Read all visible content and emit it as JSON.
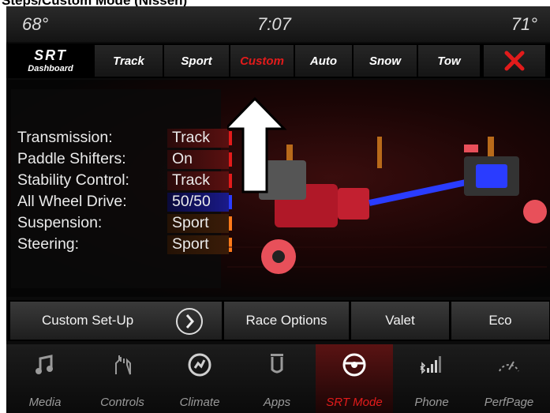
{
  "caption": "Steps/Custom Mode (Nissen)",
  "status": {
    "temp_left": "68°",
    "time": "7:07",
    "temp_right": "71°"
  },
  "tabs": {
    "logo_big": "SRT",
    "logo_small": "Dashboard",
    "items": [
      "Track",
      "Sport",
      "Custom",
      "Auto",
      "Snow",
      "Tow"
    ],
    "active": "Custom"
  },
  "settings": [
    {
      "label": "Transmission:",
      "value": "Track",
      "color": "#e21b1b"
    },
    {
      "label": "Paddle Shifters:",
      "value": "On",
      "color": "#e21b1b"
    },
    {
      "label": "Stability Control:",
      "value": "Track",
      "color": "#e21b1b"
    },
    {
      "label": "All Wheel Drive:",
      "value": "50/50",
      "color": "#2a3cff"
    },
    {
      "label": "Suspension:",
      "value": "Sport",
      "color": "#ff7a1a"
    },
    {
      "label": "Steering:",
      "value": "Sport",
      "color": "#ff7a1a"
    }
  ],
  "menu": {
    "custom_setup": "Custom Set-Up",
    "race_options": "Race Options",
    "valet": "Valet",
    "eco": "Eco"
  },
  "nav": [
    "Media",
    "Controls",
    "Climate",
    "Apps",
    "SRT Mode",
    "Phone",
    "PerfPage"
  ],
  "colors": {
    "accent": "#e21b1b",
    "awd_blue": "#2a3cff",
    "sport_orange": "#ff7a1a"
  }
}
